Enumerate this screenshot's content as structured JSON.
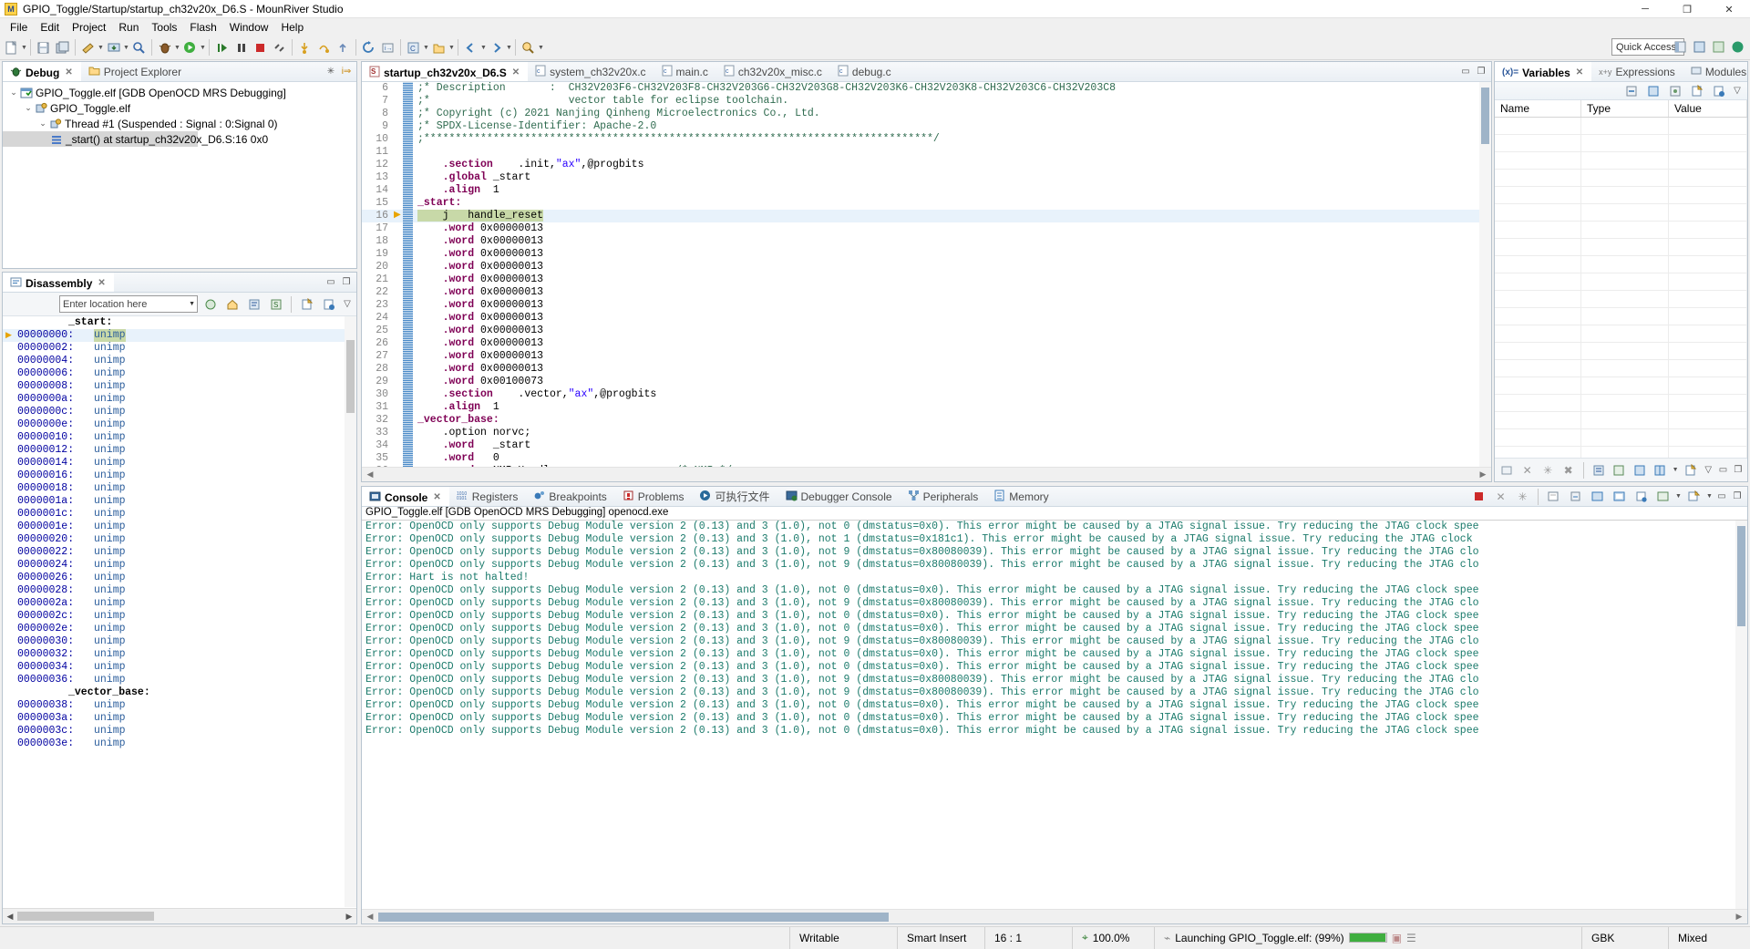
{
  "window": {
    "title": "GPIO_Toggle/Startup/startup_ch32v20x_D6.S - MounRiver Studio",
    "app_icon": "mounriver-logo-icon",
    "minimize": "─",
    "maximize": "❐",
    "close": "✕"
  },
  "menubar": [
    "File",
    "Edit",
    "Project",
    "Run",
    "Tools",
    "Flash",
    "Window",
    "Help"
  ],
  "toolbar": {
    "quick_access_placeholder": "Quick Access",
    "quick_access_value": "Quick Access"
  },
  "debug_view": {
    "tabs": [
      {
        "label": "Debug",
        "active": true,
        "icon": "bug-icon",
        "closeable": true
      },
      {
        "label": "Project Explorer",
        "active": false,
        "icon": "folder-icon",
        "closeable": false
      }
    ],
    "tree": [
      {
        "depth": 0,
        "twisty": "⌄",
        "icon": "launch-config-icon",
        "label": "GPIO_Toggle.elf [GDB OpenOCD MRS Debugging]",
        "selected": false
      },
      {
        "depth": 1,
        "twisty": "⌄",
        "icon": "process-icon",
        "label": "GPIO_Toggle.elf",
        "selected": false
      },
      {
        "depth": 2,
        "twisty": "⌄",
        "icon": "thread-icon",
        "label": "Thread #1 (Suspended : Signal : 0:Signal 0)",
        "selected": false
      },
      {
        "depth": 3,
        "twisty": "",
        "icon": "stackframe-icon",
        "label": "_start() at startup_ch32v20x_D6.S:16 0x0",
        "selected": true
      }
    ]
  },
  "disassembly_view": {
    "tab_label": "Disassembly",
    "location_placeholder": "Enter location here",
    "rows": [
      {
        "type": "label",
        "text": "_start:"
      },
      {
        "type": "code",
        "addr": "00000000:",
        "op": "unimp",
        "current": true
      },
      {
        "type": "code",
        "addr": "00000002:",
        "op": "unimp"
      },
      {
        "type": "code",
        "addr": "00000004:",
        "op": "unimp"
      },
      {
        "type": "code",
        "addr": "00000006:",
        "op": "unimp"
      },
      {
        "type": "code",
        "addr": "00000008:",
        "op": "unimp"
      },
      {
        "type": "code",
        "addr": "0000000a:",
        "op": "unimp"
      },
      {
        "type": "code",
        "addr": "0000000c:",
        "op": "unimp"
      },
      {
        "type": "code",
        "addr": "0000000e:",
        "op": "unimp"
      },
      {
        "type": "code",
        "addr": "00000010:",
        "op": "unimp"
      },
      {
        "type": "code",
        "addr": "00000012:",
        "op": "unimp"
      },
      {
        "type": "code",
        "addr": "00000014:",
        "op": "unimp"
      },
      {
        "type": "code",
        "addr": "00000016:",
        "op": "unimp"
      },
      {
        "type": "code",
        "addr": "00000018:",
        "op": "unimp"
      },
      {
        "type": "code",
        "addr": "0000001a:",
        "op": "unimp"
      },
      {
        "type": "code",
        "addr": "0000001c:",
        "op": "unimp"
      },
      {
        "type": "code",
        "addr": "0000001e:",
        "op": "unimp"
      },
      {
        "type": "code",
        "addr": "00000020:",
        "op": "unimp"
      },
      {
        "type": "code",
        "addr": "00000022:",
        "op": "unimp"
      },
      {
        "type": "code",
        "addr": "00000024:",
        "op": "unimp"
      },
      {
        "type": "code",
        "addr": "00000026:",
        "op": "unimp"
      },
      {
        "type": "code",
        "addr": "00000028:",
        "op": "unimp"
      },
      {
        "type": "code",
        "addr": "0000002a:",
        "op": "unimp"
      },
      {
        "type": "code",
        "addr": "0000002c:",
        "op": "unimp"
      },
      {
        "type": "code",
        "addr": "0000002e:",
        "op": "unimp"
      },
      {
        "type": "code",
        "addr": "00000030:",
        "op": "unimp"
      },
      {
        "type": "code",
        "addr": "00000032:",
        "op": "unimp"
      },
      {
        "type": "code",
        "addr": "00000034:",
        "op": "unimp"
      },
      {
        "type": "code",
        "addr": "00000036:",
        "op": "unimp"
      },
      {
        "type": "label",
        "text": "_vector_base:"
      },
      {
        "type": "code",
        "addr": "00000038:",
        "op": "unimp"
      },
      {
        "type": "code",
        "addr": "0000003a:",
        "op": "unimp"
      },
      {
        "type": "code",
        "addr": "0000003c:",
        "op": "unimp"
      },
      {
        "type": "code",
        "addr": "0000003e:",
        "op": "unimp"
      }
    ]
  },
  "editor": {
    "tabs": [
      {
        "label": "startup_ch32v20x_D6.S",
        "icon": "asm-file-icon",
        "active": true,
        "closeable": true
      },
      {
        "label": "system_ch32v20x.c",
        "icon": "c-file-icon",
        "active": false,
        "closeable": false
      },
      {
        "label": "main.c",
        "icon": "c-file-icon",
        "active": false,
        "closeable": false
      },
      {
        "label": "ch32v20x_misc.c",
        "icon": "c-file-icon",
        "active": false,
        "closeable": false
      },
      {
        "label": "debug.c",
        "icon": "c-file-icon",
        "active": false,
        "closeable": false
      }
    ],
    "lines": [
      {
        "n": 6,
        "marked": true,
        "parts": [
          {
            "c": "cmt",
            "t": ";* Description       :  CH32V203F6-CH32V203F8-CH32V203G6-CH32V203G8-CH32V203K6-CH32V203K8-CH32V203C6-CH32V203C8"
          }
        ]
      },
      {
        "n": 7,
        "marked": true,
        "parts": [
          {
            "c": "cmt",
            "t": ";*                      vector table for eclipse toolchain."
          }
        ]
      },
      {
        "n": 8,
        "marked": true,
        "parts": [
          {
            "c": "cmt",
            "t": ";* Copyright (c) 2021 Nanjing Qinheng Microelectronics Co., Ltd."
          }
        ]
      },
      {
        "n": 9,
        "marked": true,
        "parts": [
          {
            "c": "cmt",
            "t": ";* SPDX-License-Identifier: Apache-2.0"
          }
        ]
      },
      {
        "n": 10,
        "marked": true,
        "parts": [
          {
            "c": "cmt",
            "t": ";*********************************************************************************/"
          }
        ]
      },
      {
        "n": 11,
        "marked": true,
        "parts": [
          {
            "c": "plain",
            "t": ""
          }
        ]
      },
      {
        "n": 12,
        "marked": true,
        "parts": [
          {
            "c": "dir",
            "t": "    .section"
          },
          {
            "c": "plain",
            "t": "    .init,"
          },
          {
            "c": "str",
            "t": "\"ax\""
          },
          {
            "c": "plain",
            "t": ",@progbits"
          }
        ]
      },
      {
        "n": 13,
        "marked": true,
        "parts": [
          {
            "c": "dir",
            "t": "    .global"
          },
          {
            "c": "plain",
            "t": " _start"
          }
        ]
      },
      {
        "n": 14,
        "marked": true,
        "parts": [
          {
            "c": "dir",
            "t": "    .align"
          },
          {
            "c": "plain",
            "t": "  1"
          }
        ]
      },
      {
        "n": 15,
        "marked": true,
        "parts": [
          {
            "c": "dir",
            "t": "_start:"
          }
        ]
      },
      {
        "n": 16,
        "marked": true,
        "current": true,
        "parts": [
          {
            "c": "sel",
            "t": "    j   handle_reset"
          }
        ]
      },
      {
        "n": 17,
        "marked": true,
        "parts": [
          {
            "c": "dir",
            "t": "    .word"
          },
          {
            "c": "plain",
            "t": " 0x00000013"
          }
        ]
      },
      {
        "n": 18,
        "marked": true,
        "parts": [
          {
            "c": "dir",
            "t": "    .word"
          },
          {
            "c": "plain",
            "t": " 0x00000013"
          }
        ]
      },
      {
        "n": 19,
        "marked": true,
        "parts": [
          {
            "c": "dir",
            "t": "    .word"
          },
          {
            "c": "plain",
            "t": " 0x00000013"
          }
        ]
      },
      {
        "n": 20,
        "marked": true,
        "parts": [
          {
            "c": "dir",
            "t": "    .word"
          },
          {
            "c": "plain",
            "t": " 0x00000013"
          }
        ]
      },
      {
        "n": 21,
        "marked": true,
        "parts": [
          {
            "c": "dir",
            "t": "    .word"
          },
          {
            "c": "plain",
            "t": " 0x00000013"
          }
        ]
      },
      {
        "n": 22,
        "marked": true,
        "parts": [
          {
            "c": "dir",
            "t": "    .word"
          },
          {
            "c": "plain",
            "t": " 0x00000013"
          }
        ]
      },
      {
        "n": 23,
        "marked": true,
        "parts": [
          {
            "c": "dir",
            "t": "    .word"
          },
          {
            "c": "plain",
            "t": " 0x00000013"
          }
        ]
      },
      {
        "n": 24,
        "marked": true,
        "parts": [
          {
            "c": "dir",
            "t": "    .word"
          },
          {
            "c": "plain",
            "t": " 0x00000013"
          }
        ]
      },
      {
        "n": 25,
        "marked": true,
        "parts": [
          {
            "c": "dir",
            "t": "    .word"
          },
          {
            "c": "plain",
            "t": " 0x00000013"
          }
        ]
      },
      {
        "n": 26,
        "marked": true,
        "parts": [
          {
            "c": "dir",
            "t": "    .word"
          },
          {
            "c": "plain",
            "t": " 0x00000013"
          }
        ]
      },
      {
        "n": 27,
        "marked": true,
        "parts": [
          {
            "c": "dir",
            "t": "    .word"
          },
          {
            "c": "plain",
            "t": " 0x00000013"
          }
        ]
      },
      {
        "n": 28,
        "marked": true,
        "parts": [
          {
            "c": "dir",
            "t": "    .word"
          },
          {
            "c": "plain",
            "t": " 0x00000013"
          }
        ]
      },
      {
        "n": 29,
        "marked": true,
        "parts": [
          {
            "c": "dir",
            "t": "    .word"
          },
          {
            "c": "plain",
            "t": " 0x00100073"
          }
        ]
      },
      {
        "n": 30,
        "marked": true,
        "parts": [
          {
            "c": "dir",
            "t": "    .section"
          },
          {
            "c": "plain",
            "t": "    .vector,"
          },
          {
            "c": "str",
            "t": "\"ax\""
          },
          {
            "c": "plain",
            "t": ",@progbits"
          }
        ]
      },
      {
        "n": 31,
        "marked": true,
        "parts": [
          {
            "c": "dir",
            "t": "    .align"
          },
          {
            "c": "plain",
            "t": "  1"
          }
        ]
      },
      {
        "n": 32,
        "marked": true,
        "parts": [
          {
            "c": "dir",
            "t": "_vector_base:"
          }
        ]
      },
      {
        "n": 33,
        "marked": true,
        "parts": [
          {
            "c": "plain",
            "t": "    .option norvc;"
          }
        ]
      },
      {
        "n": 34,
        "marked": true,
        "parts": [
          {
            "c": "dir",
            "t": "    .word"
          },
          {
            "c": "plain",
            "t": "   _start"
          }
        ]
      },
      {
        "n": 35,
        "marked": true,
        "parts": [
          {
            "c": "dir",
            "t": "    .word"
          },
          {
            "c": "plain",
            "t": "   0"
          }
        ]
      },
      {
        "n": 36,
        "marked": true,
        "parts": [
          {
            "c": "dir",
            "t": "    .word"
          },
          {
            "c": "plain",
            "t": "   NMI_Handler                  "
          },
          {
            "c": "cmt",
            "t": "/* NMI */"
          }
        ]
      }
    ]
  },
  "variables_view": {
    "tabs": [
      {
        "label": "Variables",
        "icon": "variables-icon",
        "active": true,
        "closeable": true
      },
      {
        "label": "Expressions",
        "icon": "expressions-icon",
        "active": false,
        "closeable": false
      },
      {
        "label": "Modules",
        "icon": "modules-icon",
        "active": false,
        "closeable": false
      }
    ],
    "columns": [
      "Name",
      "Type",
      "Value"
    ],
    "rows": []
  },
  "console_view": {
    "tabs": [
      {
        "label": "Console",
        "icon": "console-icon",
        "active": true,
        "closeable": true
      },
      {
        "label": "Registers",
        "icon": "registers-icon",
        "active": false
      },
      {
        "label": "Breakpoints",
        "icon": "breakpoints-icon",
        "active": false
      },
      {
        "label": "Problems",
        "icon": "problems-icon",
        "active": false
      },
      {
        "label": "可执行文件",
        "icon": "executable-icon",
        "active": false
      },
      {
        "label": "Debugger Console",
        "icon": "debugger-console-icon",
        "active": false
      },
      {
        "label": "Peripherals",
        "icon": "peripherals-icon",
        "active": false
      },
      {
        "label": "Memory",
        "icon": "memory-icon",
        "active": false
      }
    ],
    "subtitle": "GPIO_Toggle.elf [GDB OpenOCD MRS Debugging] openocd.exe",
    "lines": [
      "Error: OpenOCD only supports Debug Module version 2 (0.13) and 3 (1.0), not 0 (dmstatus=0x0). This error might be caused by a JTAG signal issue. Try reducing the JTAG clock spee",
      "Error: OpenOCD only supports Debug Module version 2 (0.13) and 3 (1.0), not 1 (dmstatus=0x181c1). This error might be caused by a JTAG signal issue. Try reducing the JTAG clock",
      "Error: OpenOCD only supports Debug Module version 2 (0.13) and 3 (1.0), not 9 (dmstatus=0x80080039). This error might be caused by a JTAG signal issue. Try reducing the JTAG clo",
      "Error: OpenOCD only supports Debug Module version 2 (0.13) and 3 (1.0), not 9 (dmstatus=0x80080039). This error might be caused by a JTAG signal issue. Try reducing the JTAG clo",
      "Error: Hart is not halted!",
      "Error: OpenOCD only supports Debug Module version 2 (0.13) and 3 (1.0), not 0 (dmstatus=0x0). This error might be caused by a JTAG signal issue. Try reducing the JTAG clock spee",
      "Error: OpenOCD only supports Debug Module version 2 (0.13) and 3 (1.0), not 9 (dmstatus=0x80080039). This error might be caused by a JTAG signal issue. Try reducing the JTAG clo",
      "Error: OpenOCD only supports Debug Module version 2 (0.13) and 3 (1.0), not 0 (dmstatus=0x0). This error might be caused by a JTAG signal issue. Try reducing the JTAG clock spee",
      "Error: OpenOCD only supports Debug Module version 2 (0.13) and 3 (1.0), not 0 (dmstatus=0x0). This error might be caused by a JTAG signal issue. Try reducing the JTAG clock spee",
      "Error: OpenOCD only supports Debug Module version 2 (0.13) and 3 (1.0), not 9 (dmstatus=0x80080039). This error might be caused by a JTAG signal issue. Try reducing the JTAG clo",
      "Error: OpenOCD only supports Debug Module version 2 (0.13) and 3 (1.0), not 0 (dmstatus=0x0). This error might be caused by a JTAG signal issue. Try reducing the JTAG clock spee",
      "Error: OpenOCD only supports Debug Module version 2 (0.13) and 3 (1.0), not 0 (dmstatus=0x0). This error might be caused by a JTAG signal issue. Try reducing the JTAG clock spee",
      "Error: OpenOCD only supports Debug Module version 2 (0.13) and 3 (1.0), not 9 (dmstatus=0x80080039). This error might be caused by a JTAG signal issue. Try reducing the JTAG clo",
      "Error: OpenOCD only supports Debug Module version 2 (0.13) and 3 (1.0), not 9 (dmstatus=0x80080039). This error might be caused by a JTAG signal issue. Try reducing the JTAG clo",
      "Error: OpenOCD only supports Debug Module version 2 (0.13) and 3 (1.0), not 0 (dmstatus=0x0). This error might be caused by a JTAG signal issue. Try reducing the JTAG clock spee",
      "Error: OpenOCD only supports Debug Module version 2 (0.13) and 3 (1.0), not 0 (dmstatus=0x0). This error might be caused by a JTAG signal issue. Try reducing the JTAG clock spee",
      "Error: OpenOCD only supports Debug Module version 2 (0.13) and 3 (1.0), not 0 (dmstatus=0x0). This error might be caused by a JTAG signal issue. Try reducing the JTAG clock spee"
    ]
  },
  "statusbar": {
    "writable": "Writable",
    "insert_mode": "Smart Insert",
    "cursor_position": "16 : 1",
    "zoom": "100.0%",
    "task": "Launching GPIO_Toggle.elf: (99%)",
    "encoding": "GBK",
    "line_ending": "Mixed",
    "progress_percent": 99
  },
  "colors": {
    "accent": "#2a5699",
    "error_text": "#1a7a6b",
    "current_line": "#e8f2fb",
    "selection_green": "#c8d9a8",
    "directive": "#7f0055",
    "string": "#2a00ff",
    "comment": "#2f6b4f",
    "progress_green": "#3fae3f"
  }
}
